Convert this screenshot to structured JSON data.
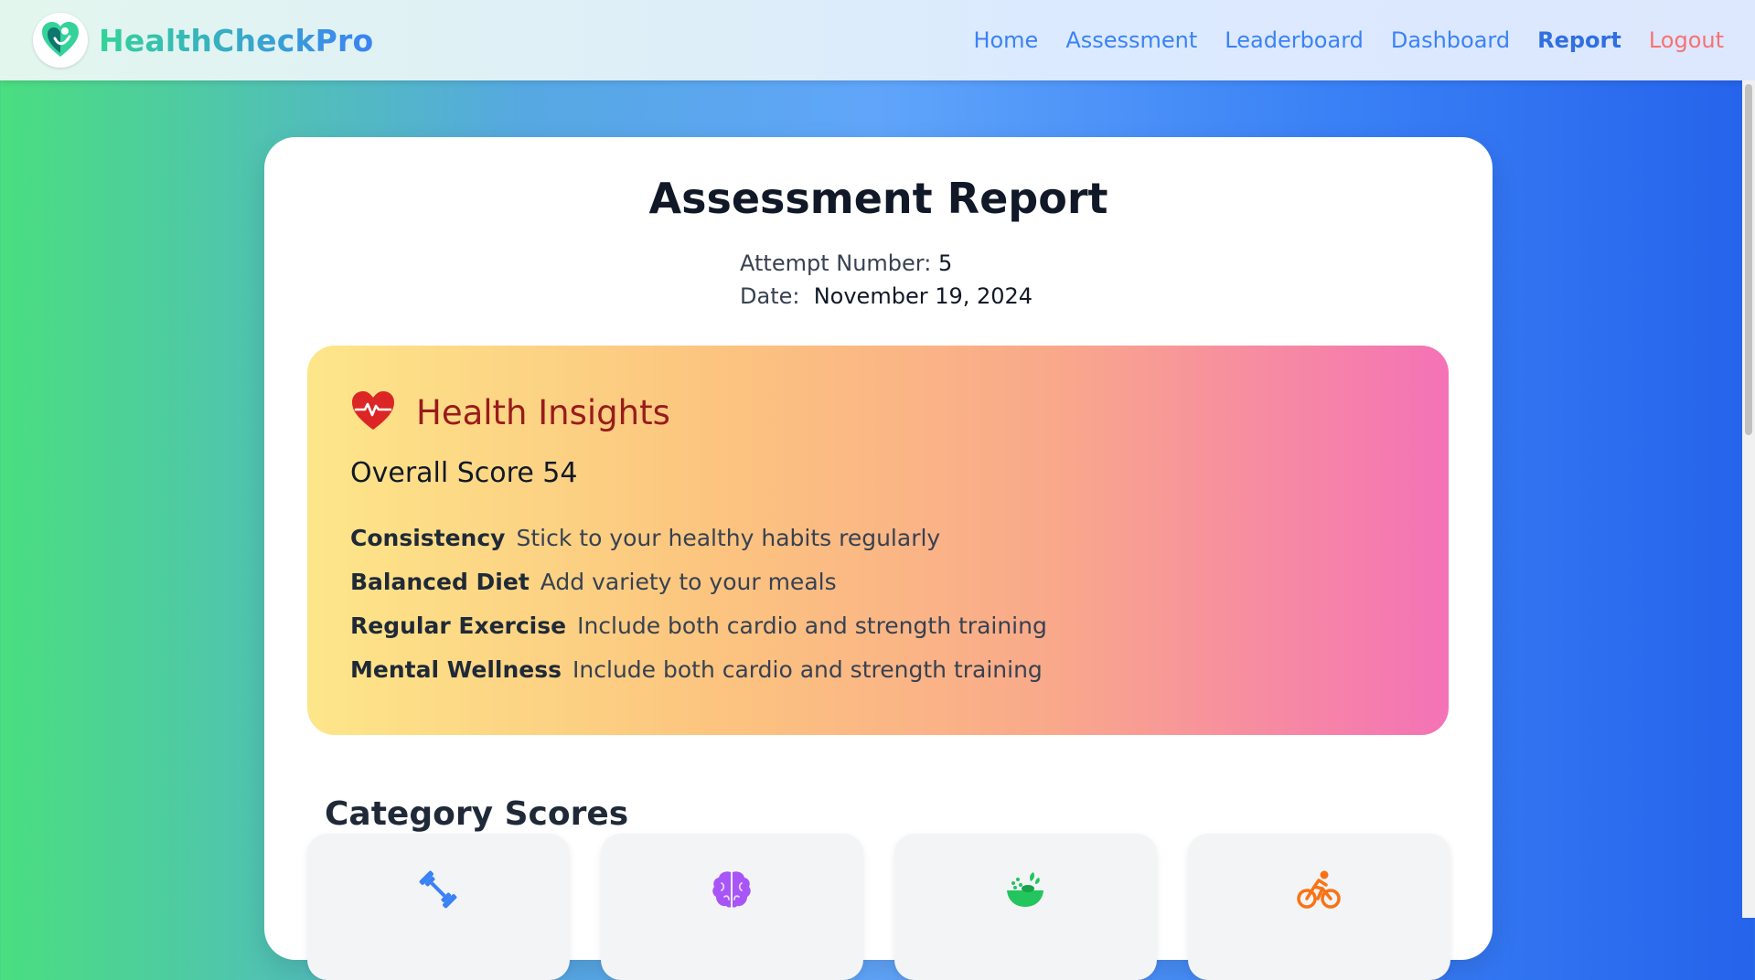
{
  "nav": {
    "brand": "HealthCheckPro",
    "links": [
      "Home",
      "Assessment",
      "Leaderboard",
      "Dashboard",
      "Report",
      "Logout"
    ],
    "active": "Report"
  },
  "report": {
    "title": "Assessment Report",
    "attempt_label": "Attempt Number:",
    "attempt_value": "5",
    "date_label": "Date:",
    "date_value": "November 19, 2024"
  },
  "insights": {
    "title": "Health Insights",
    "overall_score": "Overall Score 54",
    "tips": [
      {
        "key": "Consistency",
        "text": "Stick to your healthy habits regularly"
      },
      {
        "key": "Balanced Diet",
        "text": "Add variety to your meals"
      },
      {
        "key": "Regular Exercise",
        "text": "Include both cardio and strength training"
      },
      {
        "key": "Mental Wellness",
        "text": "Include both cardio and strength training"
      }
    ]
  },
  "categories": {
    "title": "Category Scores",
    "items": [
      {
        "icon": "dumbbell-icon",
        "color": "#3b82f6"
      },
      {
        "icon": "brain-icon",
        "color": "#a855f7"
      },
      {
        "icon": "salad-bowl-icon",
        "color": "#22c55e"
      },
      {
        "icon": "cyclist-icon",
        "color": "#f97316"
      }
    ]
  },
  "colors": {
    "accent": "#3b82f6",
    "logout": "#f87171",
    "insights_title": "#991b1b",
    "heart": "#dc2626"
  }
}
